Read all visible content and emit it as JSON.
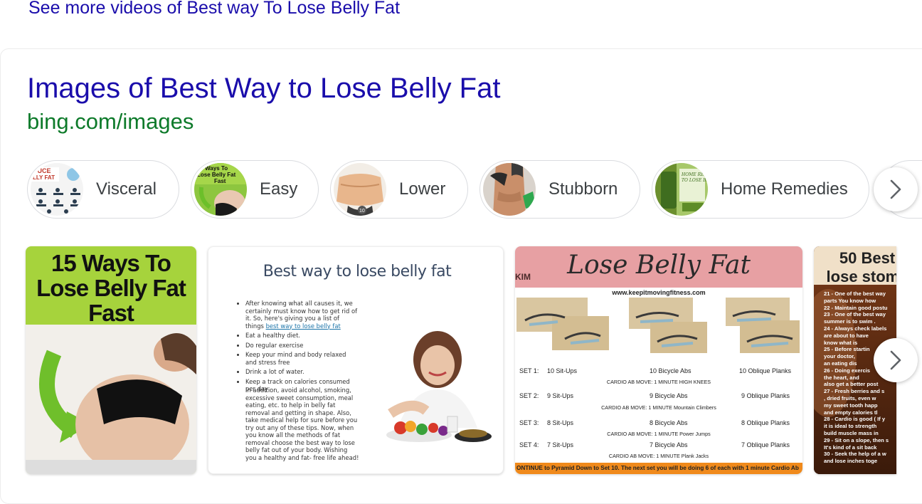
{
  "top_link": "See more videos of Best way To Lose Belly Fat",
  "card": {
    "title": "Images of Best Way to Lose Belly Fat",
    "url": "bing.com/images"
  },
  "chips": [
    {
      "label": "Visceral"
    },
    {
      "label": "Easy"
    },
    {
      "label": "Lower"
    },
    {
      "label": "Stubborn"
    },
    {
      "label": "Home Remedies"
    }
  ],
  "images": {
    "tile1": {
      "title": "15 Ways To Lose Belly Fat Fast"
    },
    "tile2": {
      "title": "Best way to lose belly fat",
      "bullets": [
        "After knowing what all causes it, we certainly must know how to get rid of it. So, here's giving you a list of things",
        "Eat a healthy diet.",
        "Do regular exercise",
        "Keep your mind and body relaxed and stress free",
        "Drink a lot of water.",
        "Keep a track on calories consumed per day"
      ],
      "bullet_link": "best way to lose belly fat",
      "paragraph": "In addition, avoid alcohol, smoking, excessive sweet consumption, meal eating, etc. to help in belly fat removal and getting in shape. Also, take medical help for sure before you try out any of these tips. Now, when you know all the methods of fat removal choose the best way to lose belly fat out of your body. Wishing you a healthy and fat- free life ahead!"
    },
    "tile3": {
      "brand": "KIM",
      "title": "Lose Belly Fat",
      "website": "www.keepitmovingfitness.com",
      "sets": [
        {
          "set": "SET 1:",
          "a": "10 Sit-Ups",
          "b": "10 Bicycle Abs",
          "c": "10 Oblique Planks",
          "cardio": "CARDIO AB MOVE: 1 MINUTE  HIGH KNEES"
        },
        {
          "set": "SET 2:",
          "a": "9 Sit-Ups",
          "b": "9 Bicycle Abs",
          "c": "9 Oblique Planks",
          "cardio": "CARDIO AB MOVE: 1 MINUTE  Mountain Climbers"
        },
        {
          "set": "SET 3:",
          "a": "8 Sit-Ups",
          "b": "8 Bicycle Abs",
          "c": "8 Oblique Planks",
          "cardio": "CARDIO AB MOVE: 1 MINUTE  Power Jumps"
        },
        {
          "set": "SET 4:",
          "a": "7 Sit-Ups",
          "b": "7 Bicycle Abs",
          "c": "7 Oblique Planks",
          "cardio": "CARDIO AB MOVE: 1 MINUTE  Plank Jacks"
        }
      ],
      "footer": "ONTINUE to Pyramid Down to Set 10. The next set you will be doing 6 of each with 1 minute Cardio Ab"
    },
    "tile4": {
      "title_line1": "50 Best",
      "title_line2": "lose stoma",
      "items": [
        "21 - One of the best way",
        "      parts You know how",
        "22 - Maintain good postu",
        "23 - One of the best way",
        "      summer is to swim .",
        "24 - Always check labels",
        "      are about to have",
        "      know what is",
        "25 - Before startin",
        "      your doctor,",
        "      an eating dis",
        "26 - Doing exercis",
        "      the heart, and",
        "      also get a better post",
        "27 -  Fresh berries and s",
        "      , dried fruits, even w",
        "      my sweet tooth happ",
        "      and empty calories tl",
        "28 - Cardio is good ( If y",
        "      it is ideal to strength",
        "      build muscle mass in",
        "29 - Sit on a slope, then s",
        "      It's kind of a sit back",
        "30 - Seek the help of a w",
        "      and lose inches toge"
      ]
    }
  },
  "colors": {
    "link": "#1a0dab",
    "url": "#0d7a2a",
    "chip_text": "#3c4043",
    "chip_border": "#dadce0"
  },
  "icons": {
    "next": "chevron-right-icon"
  }
}
